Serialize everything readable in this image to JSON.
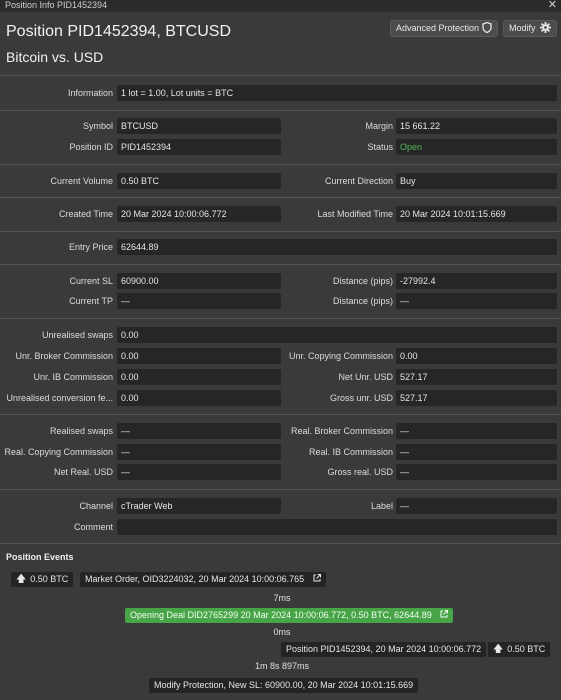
{
  "window": {
    "title": "Position Info PID1452394",
    "close_glyph": "✕"
  },
  "header": {
    "title": "Position PID1452394, BTCUSD",
    "subtitle": "Bitcoin vs. USD",
    "advanced_protection_label": "Advanced Protection",
    "modify_label": "Modify",
    "advanced_protection_icon": "shield-icon",
    "modify_icon": "gear-icon"
  },
  "colors": {
    "open_status": "#55b85a",
    "event_highlight": "#47a447",
    "background": "#3a3a3a",
    "field_bg": "#262626"
  },
  "fields": {
    "information": {
      "label": "Information",
      "value": "1 lot = 1.00, Lot units = BTC"
    },
    "symbol": {
      "label": "Symbol",
      "value": "BTCUSD"
    },
    "margin": {
      "label": "Margin",
      "value": "15 661.22"
    },
    "position_id": {
      "label": "Position ID",
      "value": "PID1452394"
    },
    "status": {
      "label": "Status",
      "value": "Open"
    },
    "current_volume": {
      "label": "Current Volume",
      "value": "0.50 BTC"
    },
    "current_direction": {
      "label": "Current Direction",
      "value": "Buy"
    },
    "created_time": {
      "label": "Created Time",
      "value": "20 Mar 2024 10:00:06.772"
    },
    "last_modified_time": {
      "label": "Last Modified Time",
      "value": "20 Mar 2024 10:01:15.669"
    },
    "entry_price": {
      "label": "Entry Price",
      "value": "62644.89"
    },
    "current_sl": {
      "label": "Current SL",
      "value": "60900.00"
    },
    "distance_sl": {
      "label": "Distance (pips)",
      "value": "-27992.4"
    },
    "current_tp": {
      "label": "Current TP",
      "value": "—"
    },
    "distance_tp": {
      "label": "Distance (pips)",
      "value": "—"
    },
    "unrealised_swaps": {
      "label": "Unrealised swaps",
      "value": "0.00"
    },
    "unr_broker_commission": {
      "label": "Unr. Broker Commission",
      "value": "0.00"
    },
    "unr_copying_commission": {
      "label": "Unr. Copying Commission",
      "value": "0.00"
    },
    "unr_ib_commission": {
      "label": "Unr. IB Commission",
      "value": "0.00"
    },
    "net_unr_usd": {
      "label": "Net Unr. USD",
      "value": "527.17"
    },
    "unrealised_conversion_fee": {
      "label": "Unrealised conversion fe...",
      "value": "0.00"
    },
    "gross_unr_usd": {
      "label": "Gross unr. USD",
      "value": "527.17"
    },
    "realised_swaps": {
      "label": "Realised swaps",
      "value": "—"
    },
    "real_broker_commission": {
      "label": "Real. Broker Commission",
      "value": "—"
    },
    "real_copying_commission": {
      "label": "Real. Copying Commission",
      "value": "—"
    },
    "real_ib_commission": {
      "label": "Real. IB Commission",
      "value": "—"
    },
    "net_real_usd": {
      "label": "Net Real. USD",
      "value": "—"
    },
    "gross_real_usd": {
      "label": "Gross real. USD",
      "value": "—"
    },
    "channel": {
      "label": "Channel",
      "value": "cTrader Web"
    },
    "label_field": {
      "label": "Label",
      "value": "—"
    },
    "comment": {
      "label": "Comment",
      "value": ""
    }
  },
  "events": {
    "section_title": "Position Events",
    "volume_1": "0.50 BTC",
    "arrow_glyph": "🡅",
    "order": "Market Order, OID3224032, 20 Mar 2024 10:00:06.765",
    "order_link_icon": "external-link-icon",
    "gap_1": "7ms",
    "deal": "Opening Deal DID2765299 20 Mar 2024 10:00:06.772, 0.50 BTC, 62644.89",
    "deal_link_icon": "external-link-icon",
    "gap_2": "0ms",
    "position": "Position PID1452394, 20 Mar 2024 10:00:06.772",
    "volume_2": "0.50 BTC",
    "gap_3": "1m 8s 897ms",
    "modify": "Modify Protection, New SL: 60900.00, 20 Mar 2024 10:01:15.669"
  }
}
